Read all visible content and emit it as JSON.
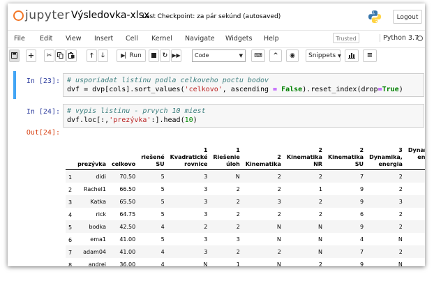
{
  "header": {
    "logo_text": "jupyter",
    "notebook_title": "Výsledovka-xlsx",
    "checkpoint": "Last Checkpoint: za pár sekúnd  (autosaved)",
    "logout_label": "Logout"
  },
  "menu": {
    "items": [
      "File",
      "Edit",
      "View",
      "Insert",
      "Cell",
      "Kernel",
      "Navigate",
      "Widgets",
      "Help"
    ],
    "trusted_label": "Trusted",
    "kernel_name": "Python 3.7"
  },
  "toolbar": {
    "run_label": "Run",
    "cell_type": "Code",
    "snippets_label": "Snippets"
  },
  "cells": [
    {
      "prompt": "In [23]:",
      "line1_comment": "# usporiadat listinu podla celkoveho poctu bodov",
      "line2_a": "dvf = dvp[cols].sort_values(",
      "line2_str": "'celkovo'",
      "line2_b": ", ascending ",
      "line2_eq": "=",
      "line2_false": "False",
      "line2_c": ").reset_index(drop",
      "line2_eq2": "=",
      "line2_true": "True",
      "line2_d": ")"
    },
    {
      "prompt": "In [24]:",
      "line1_comment": "# vypis listinu - prvych 10 miest",
      "line2_a": "dvf.loc[:,",
      "line2_str": "'prezývka'",
      "line2_b": ":].head(",
      "line2_num": "10",
      "line2_c": ")",
      "out_prompt": "Out[24]:"
    }
  ],
  "table": {
    "columns": [
      {
        "l1": "",
        "l2": "",
        "l3": ""
      },
      {
        "l1": "",
        "l2": "",
        "l3": "prezývka"
      },
      {
        "l1": "",
        "l2": "",
        "l3": "celkovo"
      },
      {
        "l1": "",
        "l2": "riešené",
        "l3": "SU"
      },
      {
        "l1": "1",
        "l2": "Kvadratické",
        "l3": "rovnice"
      },
      {
        "l1": "1",
        "l2": "Riešenie",
        "l3": "úloh"
      },
      {
        "l1": "",
        "l2": "2",
        "l3": "Kinematika"
      },
      {
        "l1": "2",
        "l2": "Kinematika",
        "l3": "NR"
      },
      {
        "l1": "2",
        "l2": "Kinematika",
        "l3": "SU"
      },
      {
        "l1": "3",
        "l2": "Dynamika,",
        "l3": "energia"
      },
      {
        "l1": "3",
        "l2": "Dynamika,",
        "l3": "energia"
      },
      {
        "l1": "",
        "l2": "",
        "l3": "Dy"
      }
    ],
    "col10_extra": "NR",
    "rows": [
      [
        "1",
        "didi",
        "70.50",
        "5",
        "3",
        "N",
        "2",
        "2",
        "7",
        "2",
        "2"
      ],
      [
        "2",
        "Rachel1",
        "66.50",
        "5",
        "3",
        "2",
        "2",
        "1",
        "9",
        "2",
        "2"
      ],
      [
        "3",
        "Katka",
        "65.50",
        "5",
        "3",
        "2",
        "3",
        "2",
        "9",
        "3",
        "2"
      ],
      [
        "4",
        "rick",
        "64.75",
        "5",
        "3",
        "2",
        "2",
        "2",
        "6",
        "2",
        "2"
      ],
      [
        "5",
        "bodka",
        "42.50",
        "4",
        "2",
        "2",
        "N",
        "N",
        "9",
        "2",
        "N"
      ],
      [
        "6",
        "ema1",
        "41.00",
        "5",
        "3",
        "3",
        "N",
        "N",
        "4",
        "N",
        "2"
      ],
      [
        "7",
        "adam04",
        "41.00",
        "4",
        "3",
        "2",
        "2",
        "N",
        "7",
        "2",
        "N"
      ],
      [
        "8",
        "andrej",
        "36.00",
        "4",
        "N",
        "1",
        "N",
        "2",
        "9",
        "N",
        "N"
      ]
    ]
  },
  "colors": {
    "accent": "#f37726",
    "prompt_in": "#303f9f",
    "prompt_out": "#d84315",
    "selected_bar": "#42a5f5"
  }
}
